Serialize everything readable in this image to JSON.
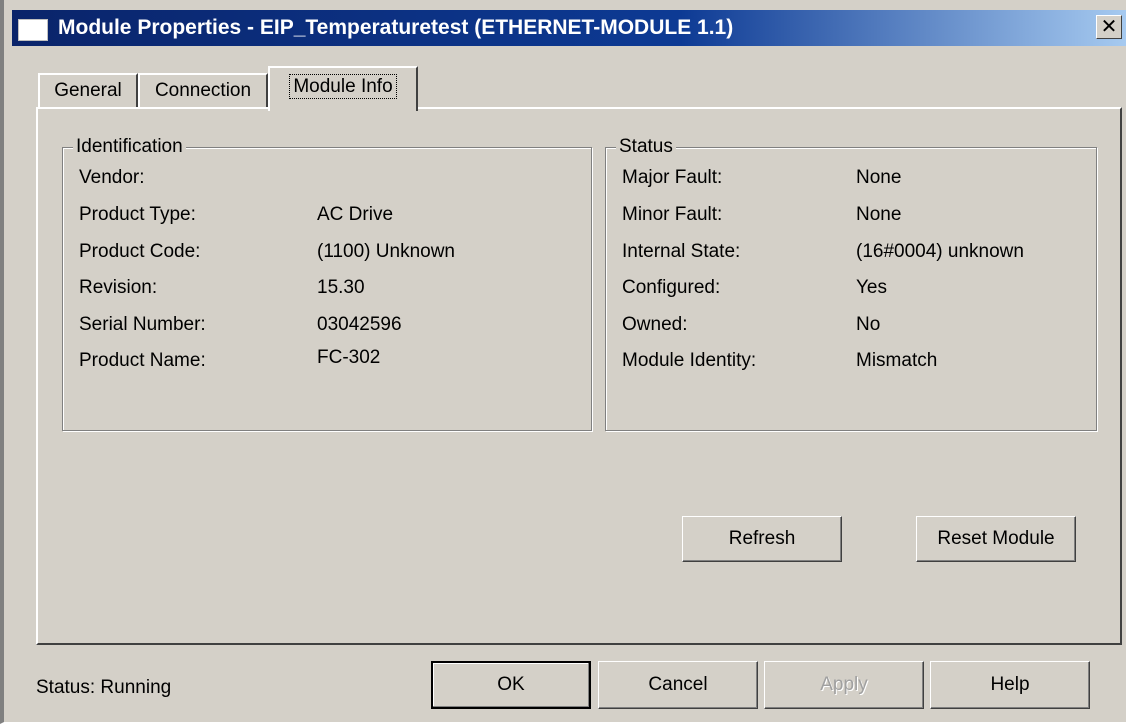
{
  "window": {
    "title": "Module Properties  - EIP_Temperaturetest (ETHERNET-MODULE 1.1)",
    "close_symbol": "✕"
  },
  "tabs": [
    {
      "label": "General",
      "active": false
    },
    {
      "label": "Connection",
      "active": false
    },
    {
      "label": "Module Info",
      "active": true
    }
  ],
  "identification": {
    "title": "Identification",
    "rows": [
      {
        "label": "Vendor:",
        "value": ""
      },
      {
        "label": "Product Type:",
        "value": "AC Drive"
      },
      {
        "label": "Product Code:",
        "value": "(1100) Unknown"
      },
      {
        "label": "Revision:",
        "value": "15.30"
      },
      {
        "label": "Serial Number:",
        "value": "03042596"
      },
      {
        "label": "Product Name:",
        "value": "FC-302"
      }
    ]
  },
  "status_group": {
    "title": "Status",
    "rows": [
      {
        "label": "Major Fault:",
        "value": "None"
      },
      {
        "label": "Minor Fault:",
        "value": "None"
      },
      {
        "label": "Internal State:",
        "value": "(16#0004) unknown"
      },
      {
        "label": "Configured:",
        "value": "Yes"
      },
      {
        "label": "Owned:",
        "value": "No"
      },
      {
        "label": "Module Identity:",
        "value": "Mismatch"
      }
    ]
  },
  "actions": {
    "refresh_label": "Refresh",
    "reset_label": "Reset Module"
  },
  "footer": {
    "status_text": "Status:  Running",
    "ok_label": "OK",
    "cancel_label": "Cancel",
    "apply_label": "Apply",
    "help_label": "Help"
  },
  "colors": {
    "titlebar_start": "#0a246a",
    "titlebar_end": "#a6caf0",
    "face": "#d4d0c8"
  },
  "icons": {
    "window_icon": "window-icon",
    "close": "close-icon"
  }
}
